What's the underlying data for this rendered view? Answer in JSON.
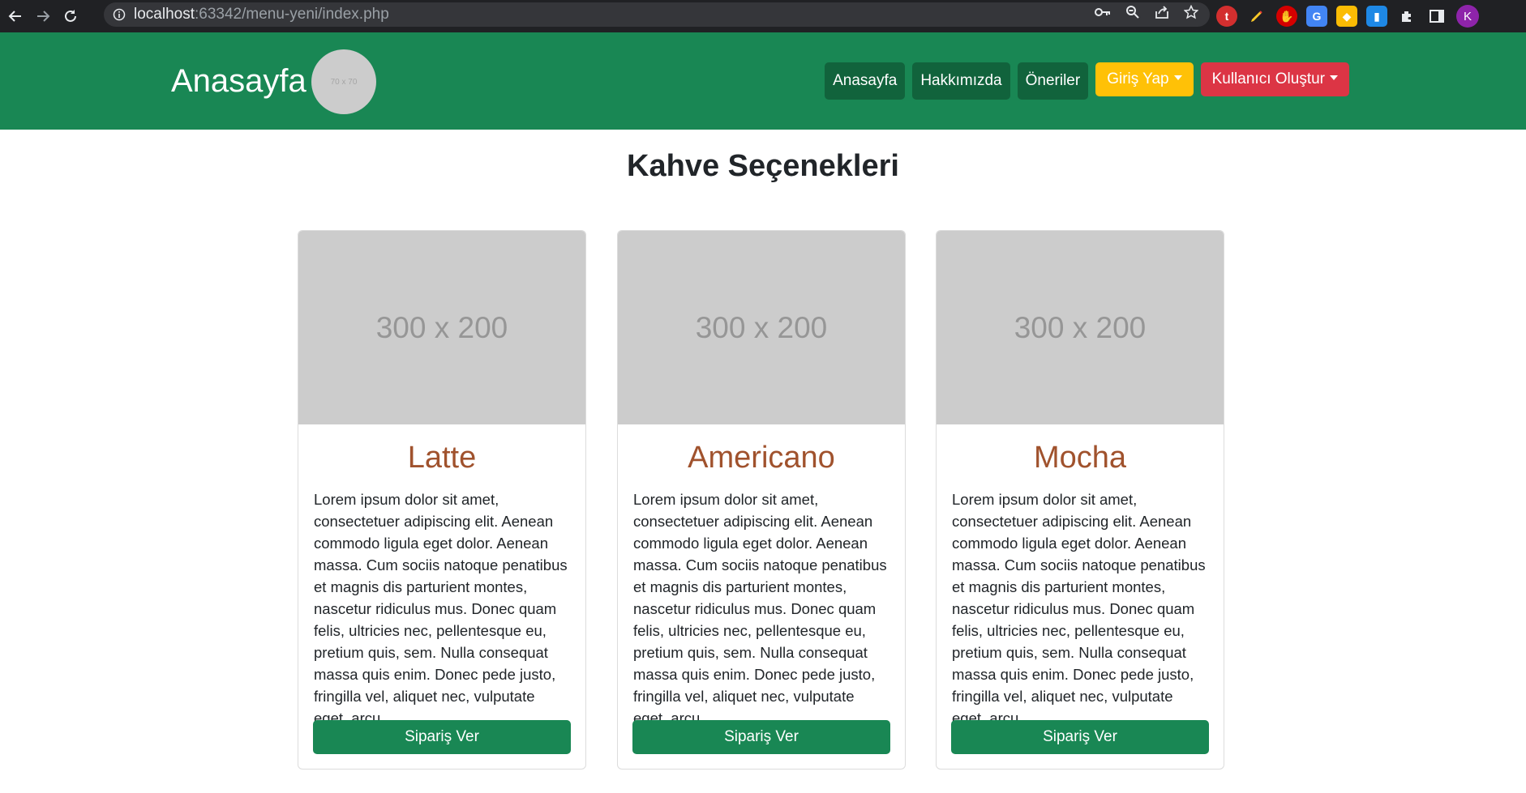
{
  "browser": {
    "url_host": "localhost",
    "url_path": ":63342/menu-yeni/index.php",
    "profile_initial": "K"
  },
  "navbar": {
    "brand": "Anasayfa",
    "logo_placeholder": "70 x 70",
    "links": [
      "Anasayfa",
      "Hakkımızda",
      "Öneriler"
    ],
    "login_label": "Giriş Yap",
    "signup_label": "Kullanıcı Oluştur"
  },
  "main": {
    "title": "Kahve Seçenekleri",
    "cards": [
      {
        "image_placeholder": "300 x 200",
        "title": "Latte",
        "text": "Lorem ipsum dolor sit amet, consectetuer adipiscing elit. Aenean commodo ligula eget dolor. Aenean massa. Cum sociis natoque penatibus et magnis dis parturient montes, nascetur ridiculus mus. Donec quam felis, ultricies nec, pellentesque eu, pretium quis, sem. Nulla consequat massa quis enim. Donec pede justo, fringilla vel, aliquet nec, vulputate eget, arcu.",
        "button": "Sipariş Ver"
      },
      {
        "image_placeholder": "300 x 200",
        "title": "Americano",
        "text": "Lorem ipsum dolor sit amet, consectetuer adipiscing elit. Aenean commodo ligula eget dolor. Aenean massa. Cum sociis natoque penatibus et magnis dis parturient montes, nascetur ridiculus mus. Donec quam felis, ultricies nec, pellentesque eu, pretium quis, sem. Nulla consequat massa quis enim. Donec pede justo, fringilla vel, aliquet nec, vulputate eget, arcu.",
        "button": "Sipariş Ver"
      },
      {
        "image_placeholder": "300 x 200",
        "title": "Mocha",
        "text": "Lorem ipsum dolor sit amet, consectetuer adipiscing elit. Aenean commodo ligula eget dolor. Aenean massa. Cum sociis natoque penatibus et magnis dis parturient montes, nascetur ridiculus mus. Donec quam felis, ultricies nec, pellentesque eu, pretium quis, sem. Nulla consequat massa quis enim. Donec pede justo, fringilla vel, aliquet nec, vulputate eget, arcu.",
        "button": "Sipariş Ver"
      }
    ]
  },
  "colors": {
    "navbar": "#198754",
    "nav_link_bg": "#11633c",
    "warning": "#ffc107",
    "danger": "#dc3545",
    "card_title": "#a0522d",
    "placeholder_gray": "#cccccc"
  },
  "icons": [
    "back-icon",
    "forward-icon",
    "reload-icon",
    "info-icon",
    "key-icon",
    "zoom-icon",
    "share-icon",
    "star-icon",
    "extensions-icon",
    "sidebar-icon"
  ]
}
